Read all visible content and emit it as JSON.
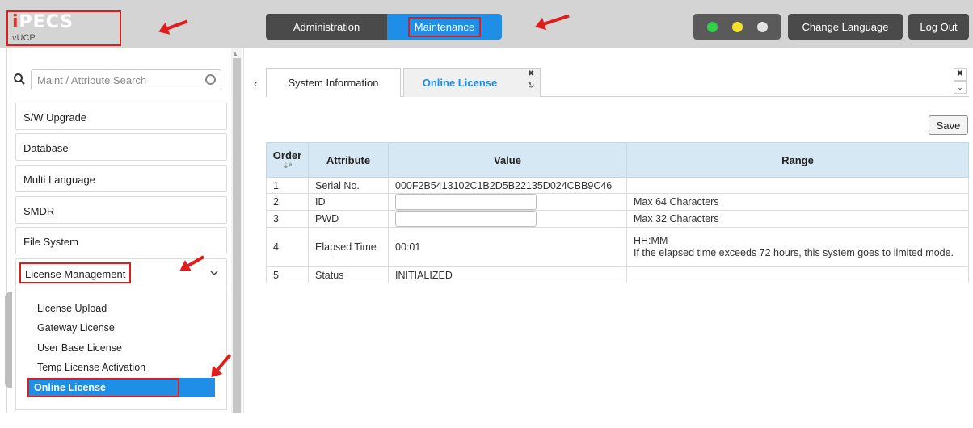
{
  "header": {
    "logo": "iPECS",
    "logo_sub": "vUCP",
    "nav": {
      "administration": "Administration",
      "maintenance": "Maintenance"
    },
    "change_language": "Change Language",
    "logout": "Log Out",
    "status_dots": [
      "#2fd04a",
      "#f3e22a",
      "#e3e3e3"
    ]
  },
  "sidebar": {
    "search_placeholder": "Maint / Attribute Search",
    "items": [
      {
        "label": "S/W Upgrade"
      },
      {
        "label": "Database"
      },
      {
        "label": "Multi Language"
      },
      {
        "label": "SMDR"
      },
      {
        "label": "File System"
      },
      {
        "label": "License Management"
      }
    ],
    "submenu": [
      {
        "label": "License Upload"
      },
      {
        "label": "Gateway License"
      },
      {
        "label": "User Base License"
      },
      {
        "label": "Temp License Activation"
      },
      {
        "label": "Online License"
      }
    ]
  },
  "tabs": [
    {
      "label": "System Information"
    },
    {
      "label": "Online License"
    }
  ],
  "toolbar": {
    "save_label": "Save"
  },
  "table": {
    "headers": {
      "order": "Order",
      "attribute": "Attribute",
      "value": "Value",
      "range": "Range"
    },
    "rows": [
      {
        "order": "1",
        "attribute": "Serial No.",
        "value": "000F2B5413102C1B2D5B22135D024CBB9C46",
        "range": ""
      },
      {
        "order": "2",
        "attribute": "ID",
        "value": "",
        "range": "Max 64 Characters"
      },
      {
        "order": "3",
        "attribute": "PWD",
        "value": "",
        "range": "Max 32 Characters"
      },
      {
        "order": "4",
        "attribute": "Elapsed Time",
        "value": "00:01",
        "range_line1": "HH:MM",
        "range_line2": "If the elapsed time exceeds 72 hours, this system goes to limited mode."
      },
      {
        "order": "5",
        "attribute": "Status",
        "value": "INITIALIZED",
        "range": ""
      }
    ]
  },
  "colors": {
    "accent": "#1e8ee6",
    "annotation": "#e01c1c",
    "header_bg": "#d4d4d4",
    "table_header": "#d7e8f5"
  }
}
